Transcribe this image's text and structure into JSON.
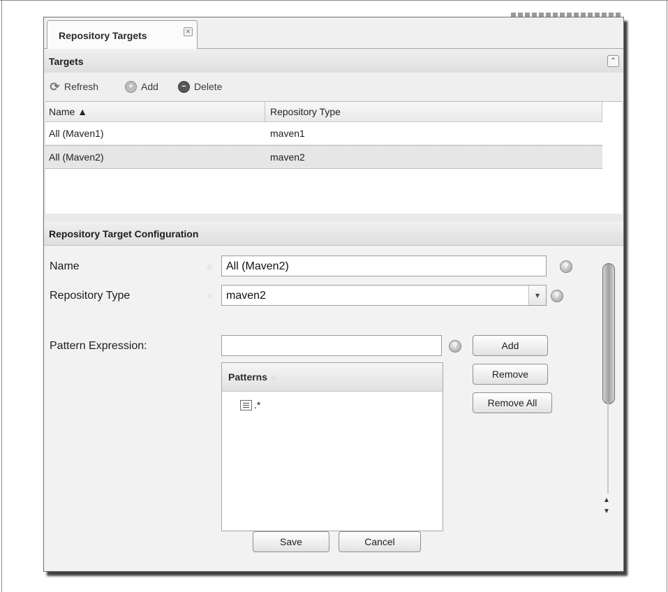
{
  "tab": {
    "label": "Repository Targets",
    "close_symbol": "✕"
  },
  "targets_panel": {
    "title": "Targets",
    "collapse_symbol": "⌃",
    "toolbar": {
      "refresh_label": "Refresh",
      "add_label": "Add",
      "delete_label": "Delete"
    },
    "columns": [
      "Name ▲",
      "Repository Type"
    ],
    "rows": [
      {
        "name": "All (Maven1)",
        "type": "maven1"
      },
      {
        "name": "All (Maven2)",
        "type": "maven2",
        "selected": true
      }
    ]
  },
  "config_panel": {
    "title": "Repository Target Configuration",
    "name_label": "Name",
    "name_value": "All (Maven2)",
    "type_label": "Repository Type",
    "type_value": "maven2",
    "pattern_label": "Pattern Expression:",
    "pattern_value": "",
    "add_label": "Add",
    "remove_label": "Remove",
    "remove_all_label": "Remove All",
    "patterns_title": "Patterns",
    "patterns": [
      ".*"
    ],
    "save_label": "Save",
    "cancel_label": "Cancel"
  }
}
